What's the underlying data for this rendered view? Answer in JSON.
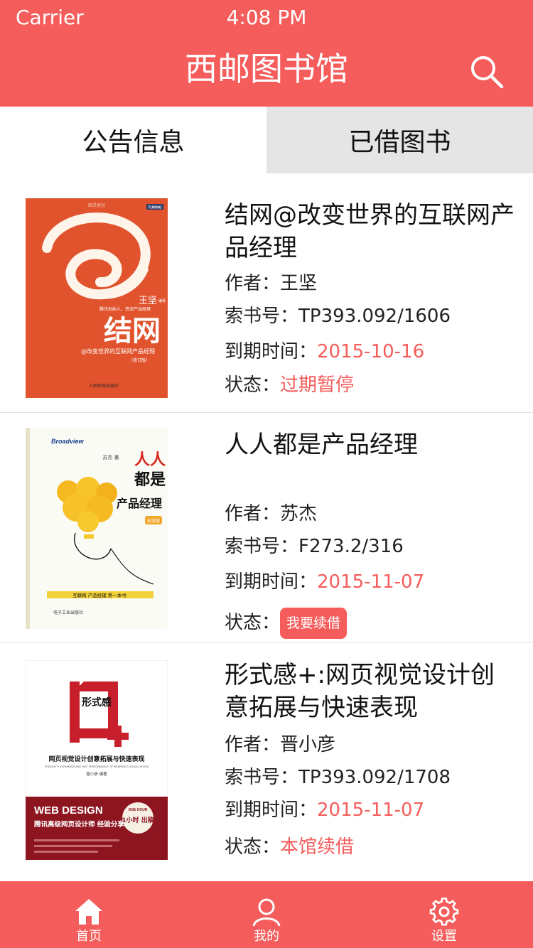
{
  "status_bar": {
    "carrier": "Carrier",
    "time": "4:08 PM"
  },
  "header": {
    "title": "西邮图书馆",
    "search_icon": "search-icon"
  },
  "tabs": [
    {
      "label": "公告信息",
      "active": true
    },
    {
      "label": "已借图书",
      "active": false
    }
  ],
  "labels": {
    "author": "作者：",
    "call_number": "索书号：",
    "due_date": "到期时间：",
    "status": "状态："
  },
  "books": [
    {
      "title": "结网@改变世界的互联网产品经理",
      "author": "王坚",
      "call_number": "TP393.092/1606",
      "due_date": "2015-10-16",
      "status": "过期暂停",
      "cover": {
        "publisher_top": "图灵原创",
        "badge": "TURING",
        "author": "王坚",
        "author_suffix": "编著",
        "tagline": "腾讯创始人、资深产品经理",
        "big_title": "结网",
        "subtitle": "@改变世界的互联网产品经理",
        "edition": "（修订版）",
        "publisher": "人民邮电出版社"
      }
    },
    {
      "title": "人人都是产品经理",
      "author": "苏杰",
      "call_number": "F273.2/316",
      "due_date": "2015-11-07",
      "status_button": "我要续借",
      "cover": {
        "brand": "Broadview",
        "author": "苏杰 著",
        "title_line1": "人人",
        "title_line2": "都是",
        "title_line3": "产品经理",
        "badge": "纪念版",
        "banner": "互联网 产品经理   第一本书",
        "publisher": "电子工业出版社"
      }
    },
    {
      "title": "形式感+:网页视觉设计创意拓展与快速表现",
      "author": "晋小彦",
      "call_number": "TP393.092/1708",
      "due_date": "2015-11-07",
      "status": "本馆续借",
      "cover": {
        "mark": "形式感",
        "main_title": "网页视觉设计创意拓展与快速表现",
        "english": "CREATIVITY EXPANDING AND FAST PERFORMANCE OF WEBPAGE'S VISUAL DESIGN",
        "author": "晋小彦 编著",
        "banner_en": "WEB DESIGN",
        "banner_cn": "腾讯高级网页设计师 经验分享",
        "badge_en": "ONE HOUR",
        "badge_cn": "1小时 出稿"
      }
    }
  ],
  "bottom_nav": [
    {
      "label": "首页",
      "icon": "home-icon"
    },
    {
      "label": "我的",
      "icon": "user-icon"
    },
    {
      "label": "设置",
      "icon": "gear-icon"
    }
  ],
  "colors": {
    "accent": "#f45d5b",
    "inactive_tab": "#e5e5e5",
    "divider": "#e3e3e3"
  }
}
